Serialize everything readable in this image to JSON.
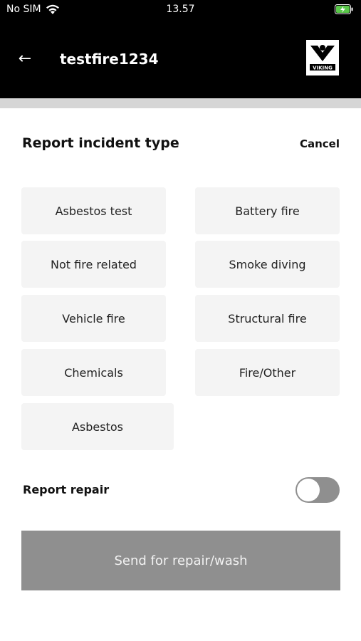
{
  "status_bar": {
    "carrier": "No SIM",
    "time": "13.57"
  },
  "header": {
    "title": "testfire1234",
    "logo_text": "VIKING"
  },
  "sheet": {
    "title": "Report incident type",
    "cancel_label": "Cancel",
    "options": [
      "Asbestos test",
      "Battery fire",
      "Not fire related",
      "Smoke diving",
      "Vehicle fire",
      "Structural fire",
      "Chemicals",
      "Fire/Other",
      "Asbestos"
    ],
    "repair_label": "Report repair",
    "repair_enabled": false,
    "send_label": "Send for repair/wash"
  },
  "colors": {
    "header_bg": "#000000",
    "button_disabled": "#8f8f8f",
    "option_bg": "#f4f4f4",
    "battery_accent": "#5ac84a"
  }
}
